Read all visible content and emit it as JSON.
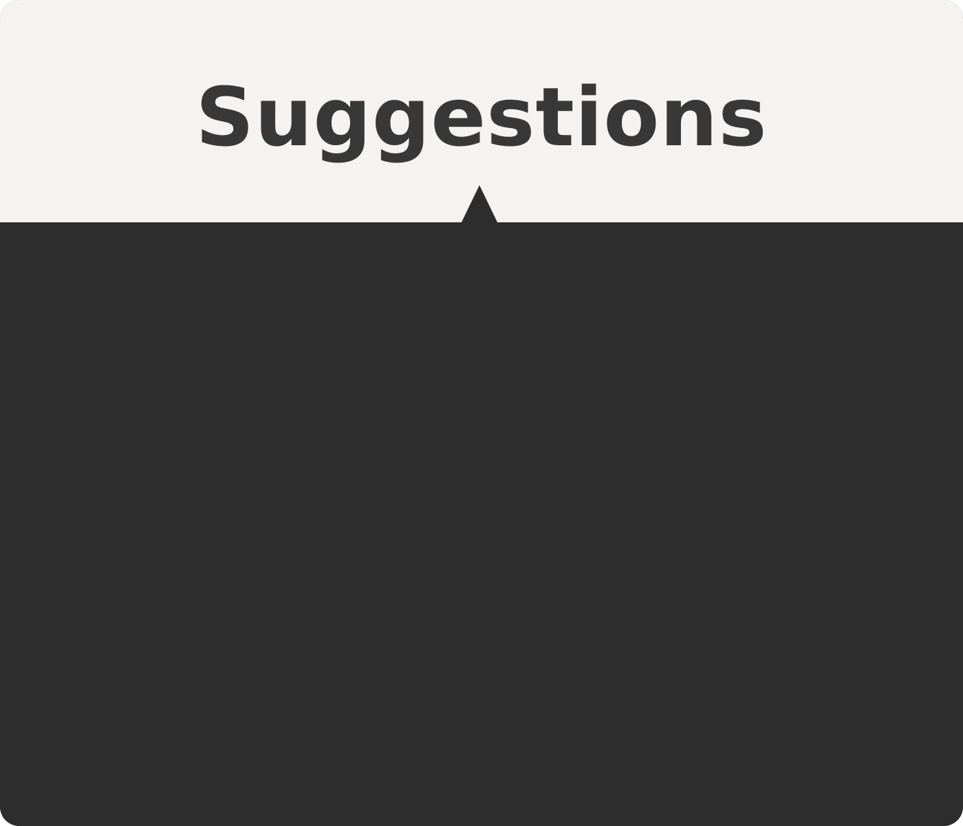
{
  "header": {
    "title": "Suggestions"
  },
  "colors": {
    "header_background": "#f4f3f1",
    "panel_background": "#2d2d2d",
    "title_text": "#383838"
  },
  "suggestions": {
    "items": []
  }
}
